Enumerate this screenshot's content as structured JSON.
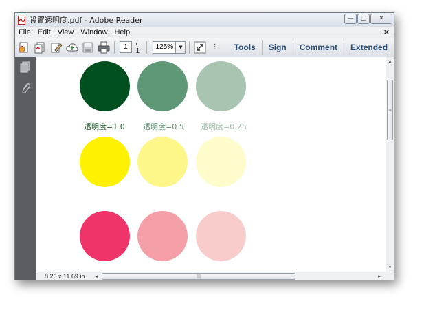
{
  "window": {
    "title": "设置透明度.pdf - Adobe Reader",
    "controls": {
      "minimize": "—",
      "maximize": "□",
      "close": "✕"
    }
  },
  "menu": {
    "items": [
      "File",
      "Edit",
      "View",
      "Window",
      "Help"
    ],
    "close_doc": "×"
  },
  "toolbar": {
    "icons": [
      "create-pdf-icon",
      "combine-files-icon",
      "edit-icon",
      "cloud-upload-icon",
      "save-icon",
      "print-icon"
    ],
    "page_current": "1",
    "page_total": "/ 1",
    "zoom": "125%",
    "zoom_arrow": "▼",
    "dots": "⋮",
    "links": [
      "Tools",
      "Sign",
      "Comment",
      "Extended"
    ]
  },
  "nav": {
    "icons": [
      "pages-icon",
      "attachments-icon"
    ]
  },
  "document": {
    "captions": [
      {
        "text": "透明度=1.0",
        "color": "#1f5a2e"
      },
      {
        "text": "透明度=0.5",
        "color": "#5f8f70"
      },
      {
        "text": "透明度=0.25",
        "color": "#9dbba9"
      }
    ],
    "rows": [
      {
        "name": "green",
        "colors": [
          "#00501f",
          "#5f9876",
          "#a8c5b1"
        ]
      },
      {
        "name": "yellow",
        "colors": [
          "#fff200",
          "#fff68a",
          "#fffccc"
        ]
      },
      {
        "name": "pink",
        "colors": [
          "#ee3469",
          "#f5a0a8",
          "#f9cccc"
        ]
      }
    ]
  },
  "status": {
    "page_size": "8.26 x 11.69 in",
    "scroll_left": "◂",
    "scroll_right": "▸",
    "scroll_up": "▴",
    "scroll_down": "▾",
    "grip": "|||",
    "vgrip": "≡"
  }
}
